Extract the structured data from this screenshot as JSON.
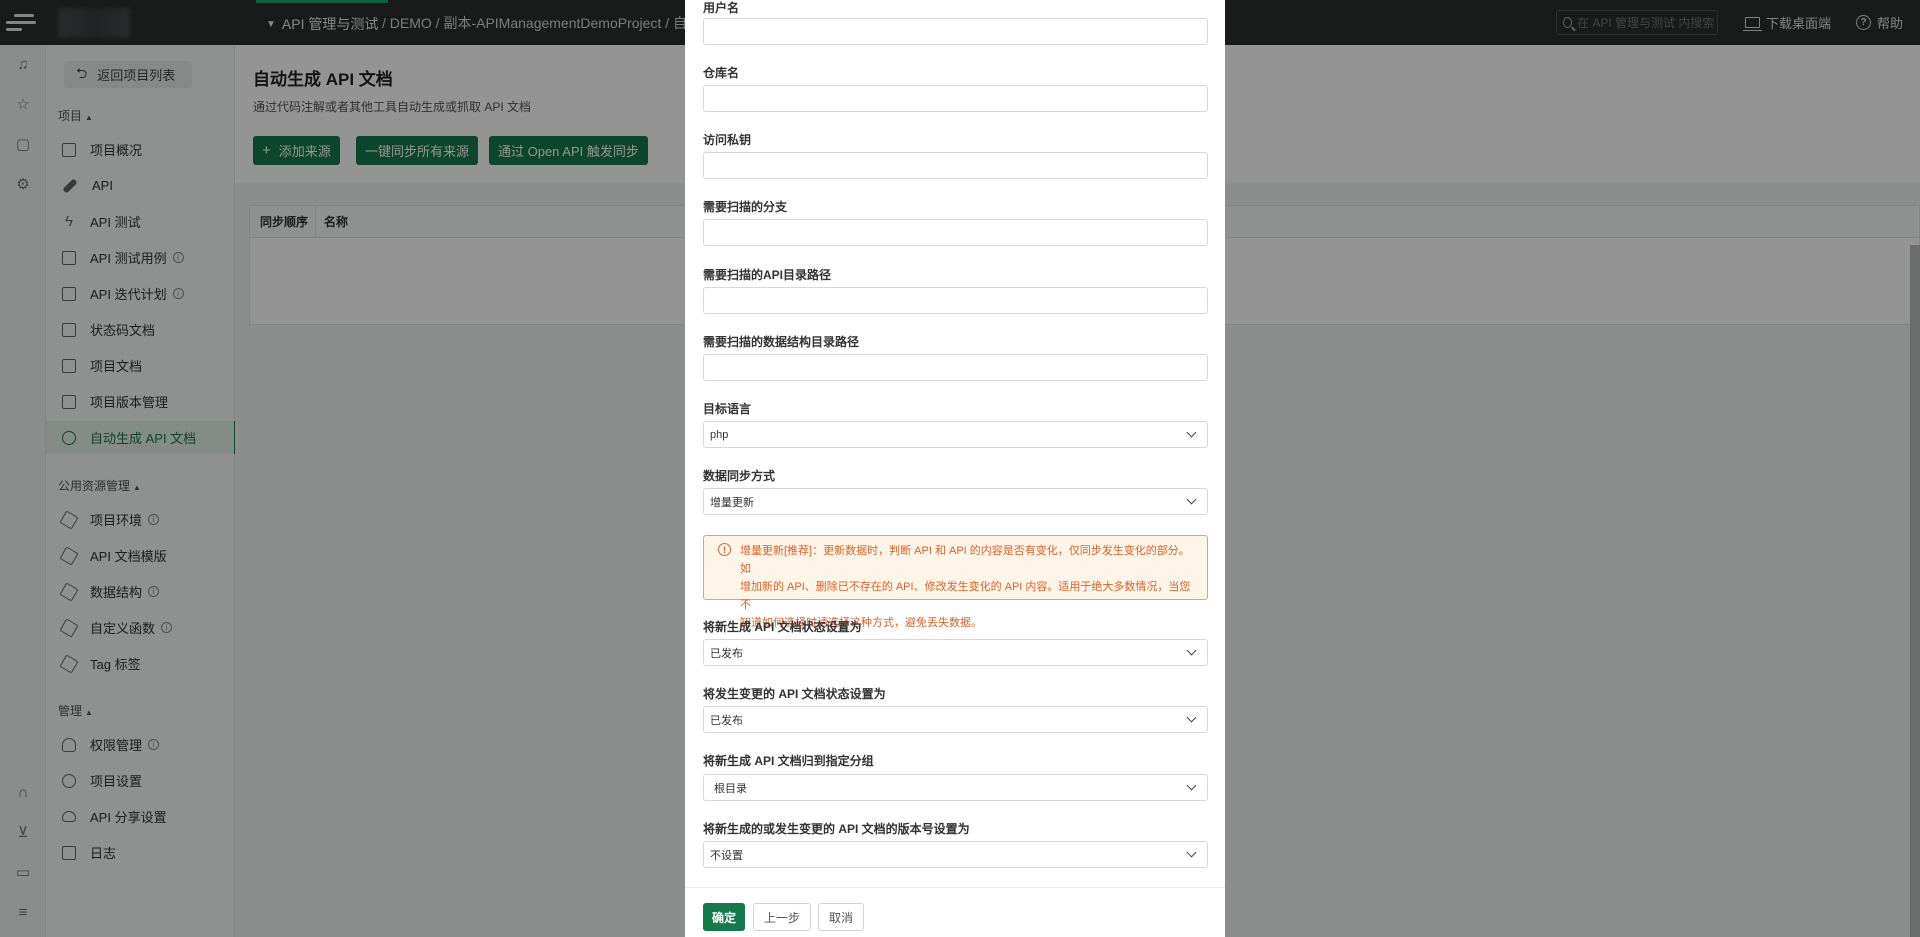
{
  "topbar": {
    "module_label": "API 管理与测试",
    "breadcrumb": "/ DEMO / 副本-APIManagementDemoProject / 自动生",
    "search_placeholder": "在 API 管理与测试 内搜索",
    "download_label": "下载桌面端",
    "help_label": "帮助"
  },
  "sidebar": {
    "back_label": "返回项目列表",
    "group_project": "项目",
    "project_items": [
      {
        "label": "项目概况"
      },
      {
        "label": "API"
      },
      {
        "label": "API 测试"
      },
      {
        "label": "API 测试用例"
      },
      {
        "label": "API 迭代计划"
      },
      {
        "label": "状态码文档"
      },
      {
        "label": "项目文档"
      },
      {
        "label": "项目版本管理"
      },
      {
        "label": "自动生成 API 文档"
      }
    ],
    "group_public": "公用资源管理",
    "public_items": [
      {
        "label": "项目环境"
      },
      {
        "label": "API 文档模版"
      },
      {
        "label": "数据结构"
      },
      {
        "label": "自定义函数"
      },
      {
        "label": "Tag 标签"
      }
    ],
    "group_manage": "管理",
    "manage_items": [
      {
        "label": "权限管理"
      },
      {
        "label": "项目设置"
      },
      {
        "label": "API 分享设置"
      },
      {
        "label": "日志"
      }
    ]
  },
  "main": {
    "title": "自动生成 API 文档",
    "description": "通过代码注解或者其他工具自动生成或抓取 API 文档",
    "buttons": {
      "add_source": "添加来源",
      "sync_all": "一键同步所有来源",
      "open_api_sync": "通过 Open API 触发同步"
    },
    "table_headers": [
      "同步顺序",
      "名称"
    ]
  },
  "modal": {
    "fields": {
      "username": {
        "label": "用户名",
        "value": ""
      },
      "repo": {
        "label": "仓库名",
        "value": ""
      },
      "token": {
        "label": "访问私钥",
        "value": ""
      },
      "branch": {
        "label": "需要扫描的分支",
        "value": ""
      },
      "api_path": {
        "label": "需要扫描的API目录路径",
        "value": ""
      },
      "struct_path": {
        "label": "需要扫描的数据结构目录路径",
        "value": ""
      }
    },
    "selects": {
      "language": {
        "label": "目标语言",
        "value": "php"
      },
      "sync_mode": {
        "label": "数据同步方式",
        "value": "增量更新"
      },
      "new_status": {
        "label": "将新生成 API 文档状态设置为",
        "value": "已发布"
      },
      "changed_status": {
        "label": "将发生变更的 API 文档状态设置为",
        "value": "已发布"
      },
      "group": {
        "label": "将新生成 API 文档归到指定分组",
        "value": "根目录"
      },
      "version": {
        "label": "将新生成的或发生变更的 API 文档的版本号设置为",
        "value": "不设置"
      }
    },
    "alert": {
      "line1": "增量更新[推荐]：更新数据时，判断 API 和 API 的内容是否有变化，仅同步发生变化的部分。如",
      "line2": "增加新的 API、删除已不存在的 API、修改发生变化的 API 内容。适用于绝大多数情况，当您不",
      "line3": "知道如何选择时请选择这种方式，避免丢失数据。"
    },
    "footer": {
      "confirm": "确定",
      "prev": "上一步",
      "cancel": "取消"
    }
  },
  "colors": {
    "brand": "#16794c",
    "topbar": "#2b2d2e",
    "warning": "#d9642b"
  }
}
